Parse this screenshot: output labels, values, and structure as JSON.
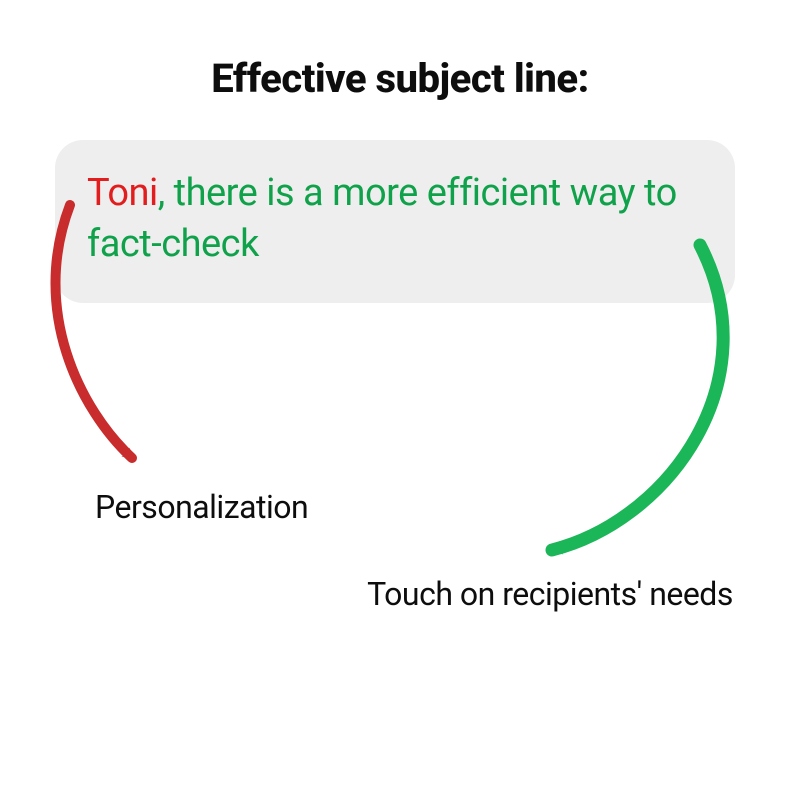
{
  "title": "Effective subject line:",
  "subject_line": {
    "name": "Toni",
    "comma": ", ",
    "rest": "there is a more efficient way to fact-check"
  },
  "labels": {
    "personalization": "Personalization",
    "needs": "Touch on recipients' needs"
  },
  "colors": {
    "red": "#c82c2c",
    "green": "#1bb658"
  }
}
